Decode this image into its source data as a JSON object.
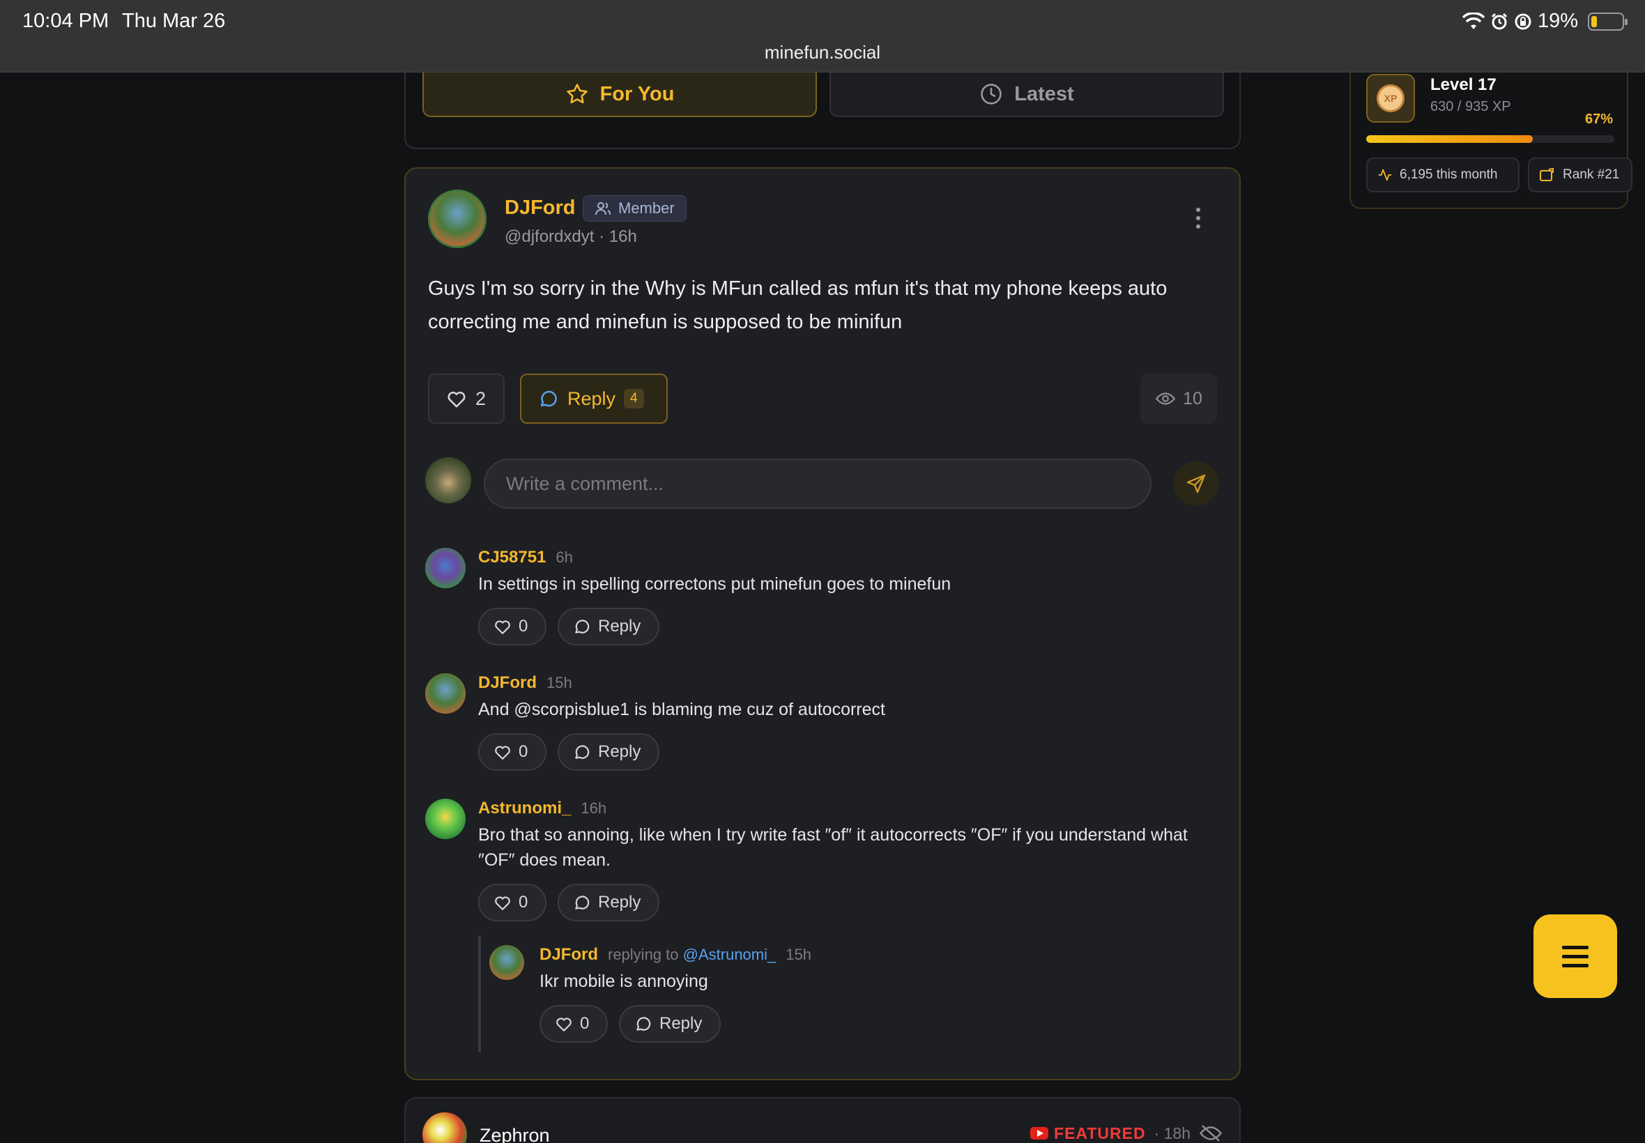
{
  "status_bar": {
    "time": "10:04 PM",
    "date": "Thu Mar 26",
    "battery": "19%",
    "battery_level": 0.19
  },
  "browser": {
    "url": "minefun.social"
  },
  "feed_tabs": [
    {
      "label": "For You",
      "icon": "star-icon",
      "active": true
    },
    {
      "label": "Latest",
      "icon": "clock-icon",
      "active": false
    }
  ],
  "level": {
    "title": "Level 17",
    "xp": "630 / 935 XP",
    "percent_label": "67%",
    "progress": 0.67,
    "month_label": "6,195 this month",
    "rank_label": "Rank #21"
  },
  "post": {
    "author": "DJFord",
    "badge": "Member",
    "handle": "@djfordxdyt",
    "time": "· 16h",
    "body": "Guys I'm so sorry in the Why is MFun called as mfun it's that my phone keeps auto correcting me and minefun is supposed to be minifun",
    "likes": "2",
    "reply_label": "Reply",
    "reply_count": "4",
    "views": "10",
    "comment_placeholder": "Write a comment..."
  },
  "comments": [
    {
      "author": "CJ58751",
      "time": "6h",
      "text": "In settings in spelling correctons put minefun goes to minefun",
      "likes": "0",
      "reply_label": "Reply"
    },
    {
      "author": "DJFord",
      "time": "15h",
      "text": "And @scorpisblue1 is blaming me cuz of autocorrect",
      "likes": "0",
      "reply_label": "Reply"
    },
    {
      "author": "Astrunomi_",
      "time": "16h",
      "text": "Bro that so annoing, like when I try write fast ″of″ it autocorrects ″OF″ if you understand what ″OF″ does mean.",
      "likes": "0",
      "reply_label": "Reply"
    }
  ],
  "nested_reply": {
    "author": "DJFord",
    "replying_to_prefix": "replying to",
    "replying_to": "@Astrunomi_",
    "time": "15h",
    "text": "Ikr mobile is annoying",
    "likes": "0",
    "reply_label": "Reply"
  },
  "next_post": {
    "author": "Zephron",
    "featured_label": "FEATURED",
    "time": "· 18h"
  },
  "colors": {
    "accent": "#f5b82e",
    "background": "#111214",
    "card": "#1e1f22",
    "mention": "#5aa0f0",
    "featured": "#ef3b3b"
  }
}
